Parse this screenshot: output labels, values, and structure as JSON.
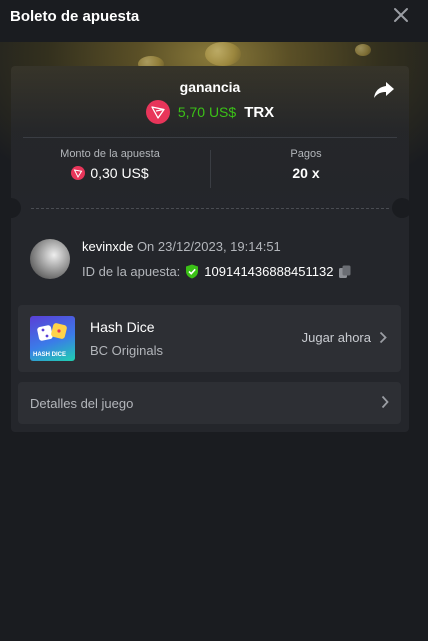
{
  "header": {
    "title": "Boleto de apuesta"
  },
  "win": {
    "label": "ganancia",
    "amount": "5,70 US$",
    "currency": "TRX"
  },
  "stats": {
    "bet_label": "Monto de la apuesta",
    "bet_value": "0,30 US$",
    "payout_label": "Pagos",
    "payout_value": "20 x"
  },
  "user": {
    "name": "kevinxde",
    "date": "On 23/12/2023, 19:14:51",
    "bet_id_label": "ID de la apuesta:",
    "bet_id": "109141436888451132"
  },
  "game": {
    "name": "Hash Dice",
    "provider": "BC Originals",
    "play_label": "Jugar ahora",
    "thumb_label": "HASH DICE"
  },
  "details": {
    "label": "Detalles del juego"
  },
  "colors": {
    "win_green": "#3bc117",
    "trx_red": "#e8355a",
    "background": "#1a1c20",
    "card": "#24262b"
  }
}
